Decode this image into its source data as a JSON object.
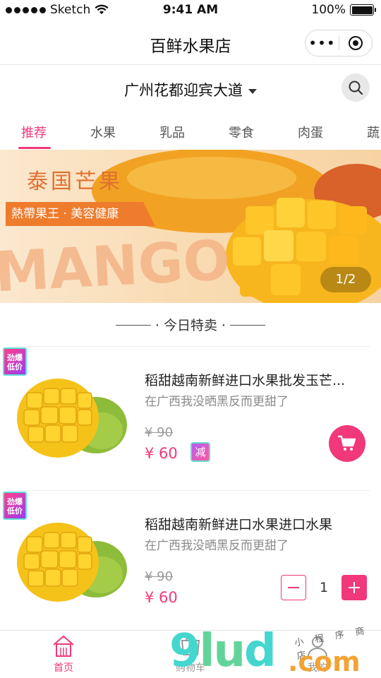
{
  "status_bar": {
    "carrier": "Sketch",
    "time": "9:41 AM",
    "battery": "100%"
  },
  "nav": {
    "title": "百鲜水果店",
    "more_icon": "more-dots-icon",
    "close_icon": "target-icon"
  },
  "location": {
    "text": "广州花都迎宾大道",
    "search_icon": "search-icon"
  },
  "categories": [
    "推荐",
    "水果",
    "乳品",
    "零食",
    "肉蛋",
    "蔬"
  ],
  "active_category": "推荐",
  "banner": {
    "title": "泰国芒果",
    "ribbon": "熱帶果王 · 美容健康",
    "big_text": "MANGO",
    "pager": "1/2"
  },
  "section": {
    "title": "· 今日特卖 ·"
  },
  "products": [
    {
      "badge": "劲爆\n低价",
      "name": "稻甜越南新鲜进口水果批发玉芒...",
      "desc": "在广西我没晒黑反而更甜了",
      "old_price": "¥ 90",
      "price": "¥ 60",
      "tag": "减",
      "action": "cart"
    },
    {
      "badge": "劲爆\n低价",
      "name": "稻甜越南新鲜进口水果进口水果",
      "desc": "在广西我没晒黑反而更甜了",
      "old_price": "¥ 90",
      "price": "¥ 60",
      "quantity": "1",
      "action": "stepper"
    }
  ],
  "tab_bar": [
    {
      "label": "首页",
      "icon": "home-icon",
      "active": true
    },
    {
      "label": "购物车",
      "icon": "cart-icon",
      "active": false
    },
    {
      "label": "我的",
      "icon": "user-icon",
      "active": false
    }
  ],
  "watermark": {
    "big": "9lud",
    "small": "小 程 序 商 店",
    "com": ".com"
  },
  "colors": {
    "accent": "#f0387a",
    "banner_orange": "#ef7c2d"
  }
}
